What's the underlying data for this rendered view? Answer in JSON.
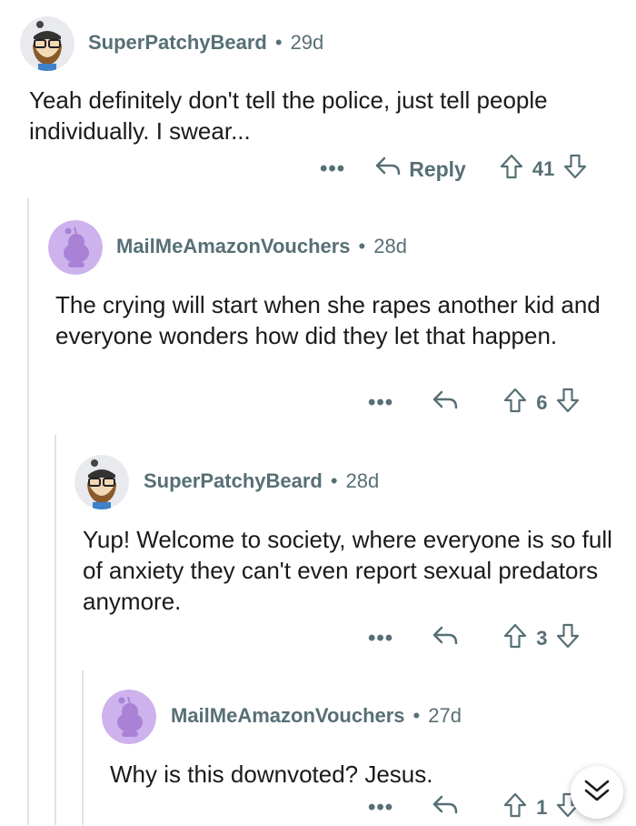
{
  "comments": [
    {
      "username": "SuperPatchyBeard",
      "age": "29d",
      "body": "Yeah definitely don't tell the police, just tell people individually. I swear...",
      "reply_label": "Reply",
      "score": "41",
      "avatar": "bearded-snoo-avatar"
    },
    {
      "username": "MailMeAmazonVouchers",
      "age": "28d",
      "body": "The crying will start when she rapes another kid and everyone wonders how did they let that happen.",
      "reply_label": "",
      "score": "6",
      "avatar": "default-snoo-avatar"
    },
    {
      "username": "SuperPatchyBeard",
      "age": "28d",
      "body": "Yup! Welcome to society, where everyone is so full of anxiety they can't even report sexual predators anymore.",
      "reply_label": "",
      "score": "3",
      "avatar": "bearded-snoo-avatar"
    },
    {
      "username": "MailMeAmazonVouchers",
      "age": "27d",
      "body": "Why is this downvoted? Jesus.",
      "reply_label": "",
      "score": "1",
      "avatar": "default-snoo-avatar"
    }
  ],
  "ui": {
    "separator": "•",
    "more_label": "•••",
    "scroll_icon": "double-chevron-down-icon",
    "colors": {
      "meta": "#576f76",
      "text": "#1a1a1b",
      "avatar_purple": "#cdb2ee",
      "thread_line": "#e3e3e3"
    }
  }
}
